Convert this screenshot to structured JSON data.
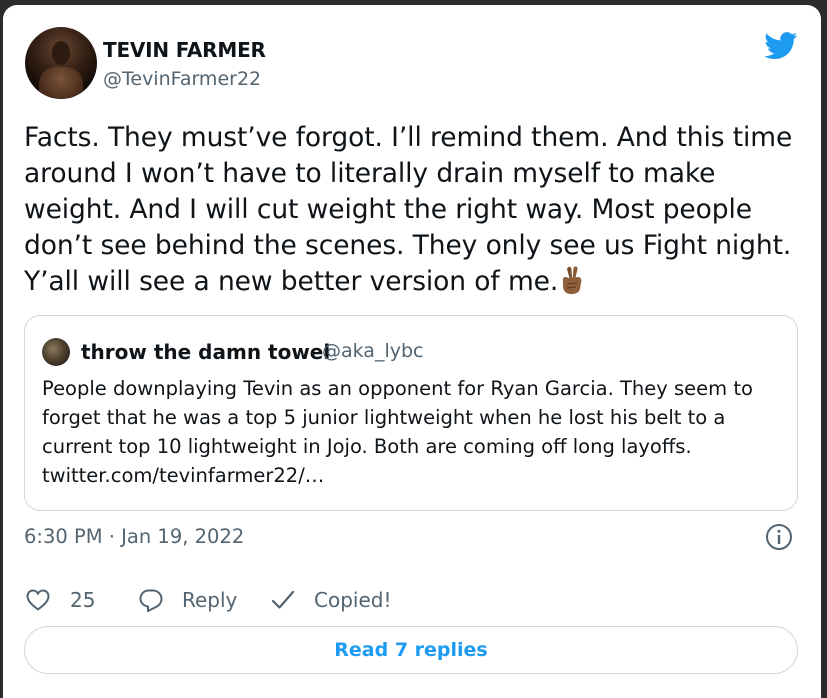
{
  "author": {
    "name": "TEVIN FARMER",
    "handle": "@TevinFarmer22"
  },
  "tweet": {
    "text": "Facts. They must’ve forgot. I’ll remind them. And this time around I won’t have to literally drain myself to make weight. And I will cut weight the right way. Most people don’t see behind the scenes. They only see us Fight night. Y’all will see a new better version of me.",
    "emoji": "crossed-fingers-emoji",
    "timestamp": "6:30 PM · Jan 19, 2022"
  },
  "quoted_tweet": {
    "name": "throw the damn towel",
    "handle": "@aka_lybc",
    "text": "People downplaying Tevin as an opponent for Ryan Garcia. They seem to forget that he was a top 5 junior lightweight when he lost his belt to a current top 10 lightweight in Jojo. Both are coming off long layoffs. twitter.com/tevinfarmer22/…"
  },
  "actions": {
    "like_count": "25",
    "reply_label": "Reply",
    "copy_label": "Copied!"
  },
  "read_replies_label": "Read 7 replies",
  "colors": {
    "accent": "#1d9bf0",
    "muted": "#536471",
    "border": "#cfd9de"
  },
  "icons": [
    "twitter-bird-icon",
    "info-icon",
    "heart-icon",
    "reply-bubble-icon",
    "checkmark-icon"
  ]
}
